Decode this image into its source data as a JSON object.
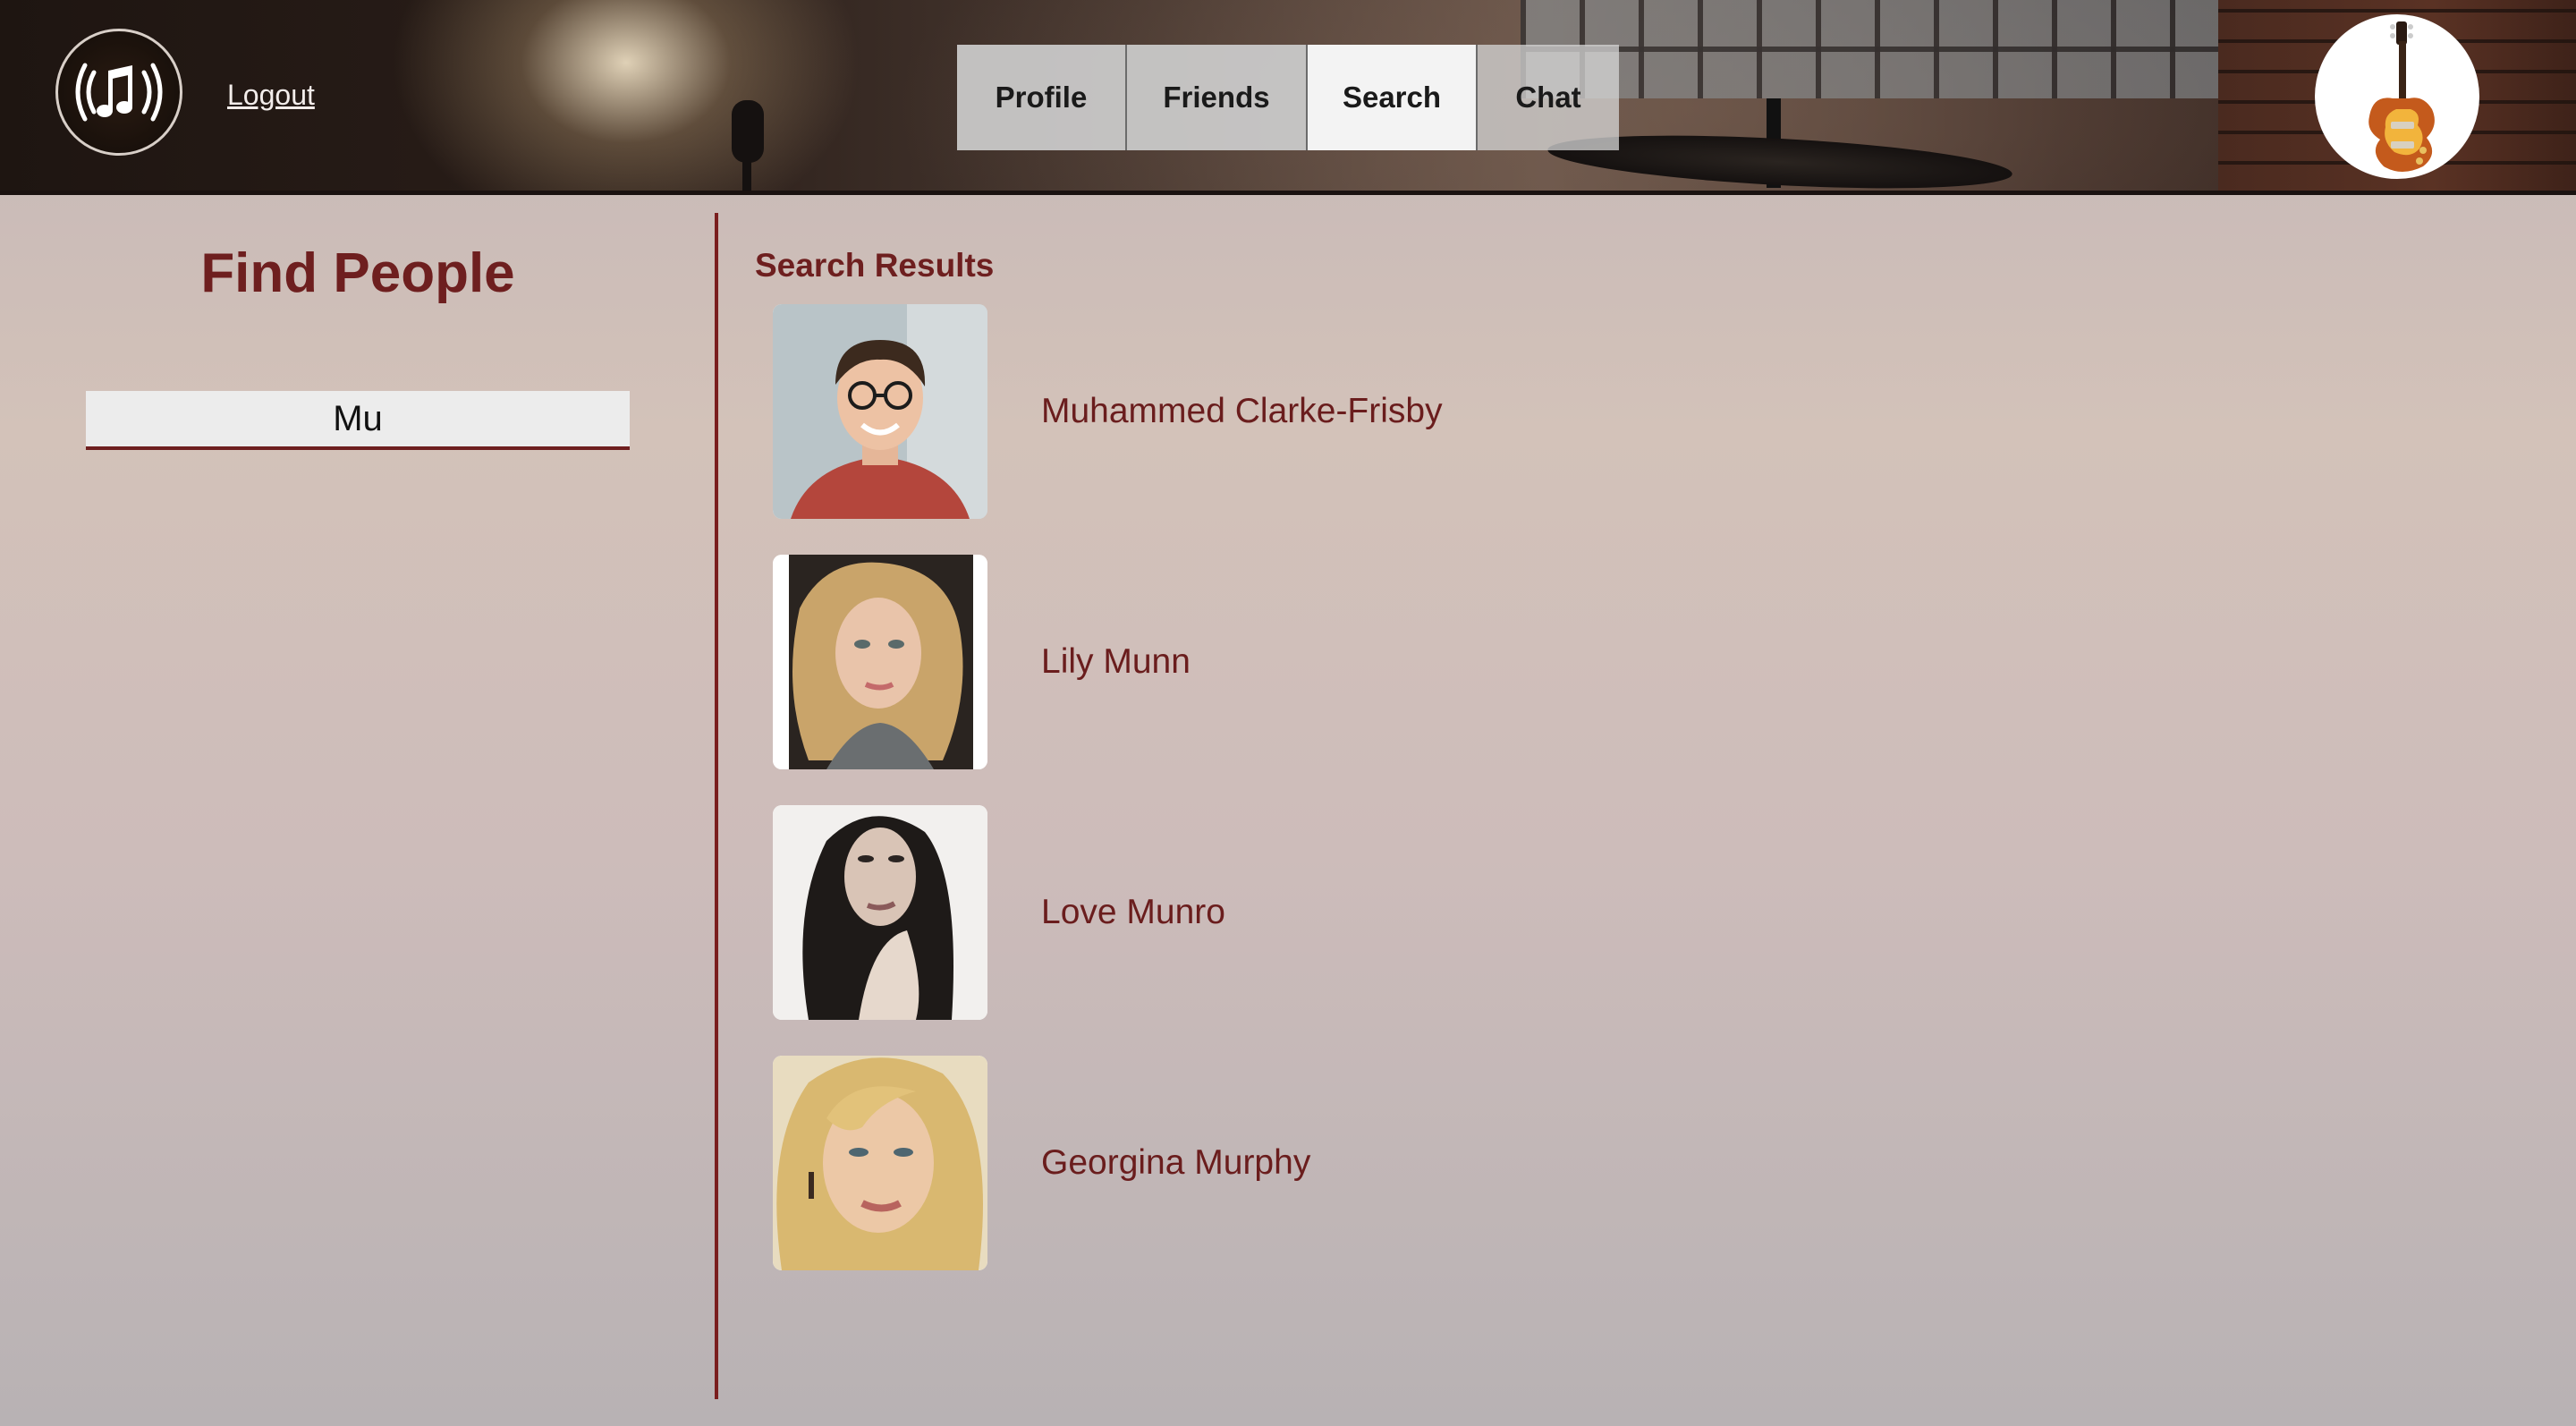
{
  "header": {
    "logout_label": "Logout",
    "nav": [
      {
        "label": "Profile",
        "active": false
      },
      {
        "label": "Friends",
        "active": false
      },
      {
        "label": "Search",
        "active": true
      },
      {
        "label": "Chat",
        "active": false
      }
    ]
  },
  "left_panel": {
    "title": "Find People",
    "search_value": "Mu"
  },
  "results": {
    "title": "Search Results",
    "items": [
      {
        "name": "Muhammed Clarke-Frisby"
      },
      {
        "name": "Lily Munn"
      },
      {
        "name": "Love Munro"
      },
      {
        "name": "Georgina Murphy"
      }
    ]
  },
  "colors": {
    "accent": "#6e1f1f",
    "tab_bg": "#cdcdcd",
    "tab_active_bg": "#f3f3f3"
  },
  "icons": {
    "logo": "music-note-broadcast-icon",
    "badge": "electric-guitar-icon"
  }
}
